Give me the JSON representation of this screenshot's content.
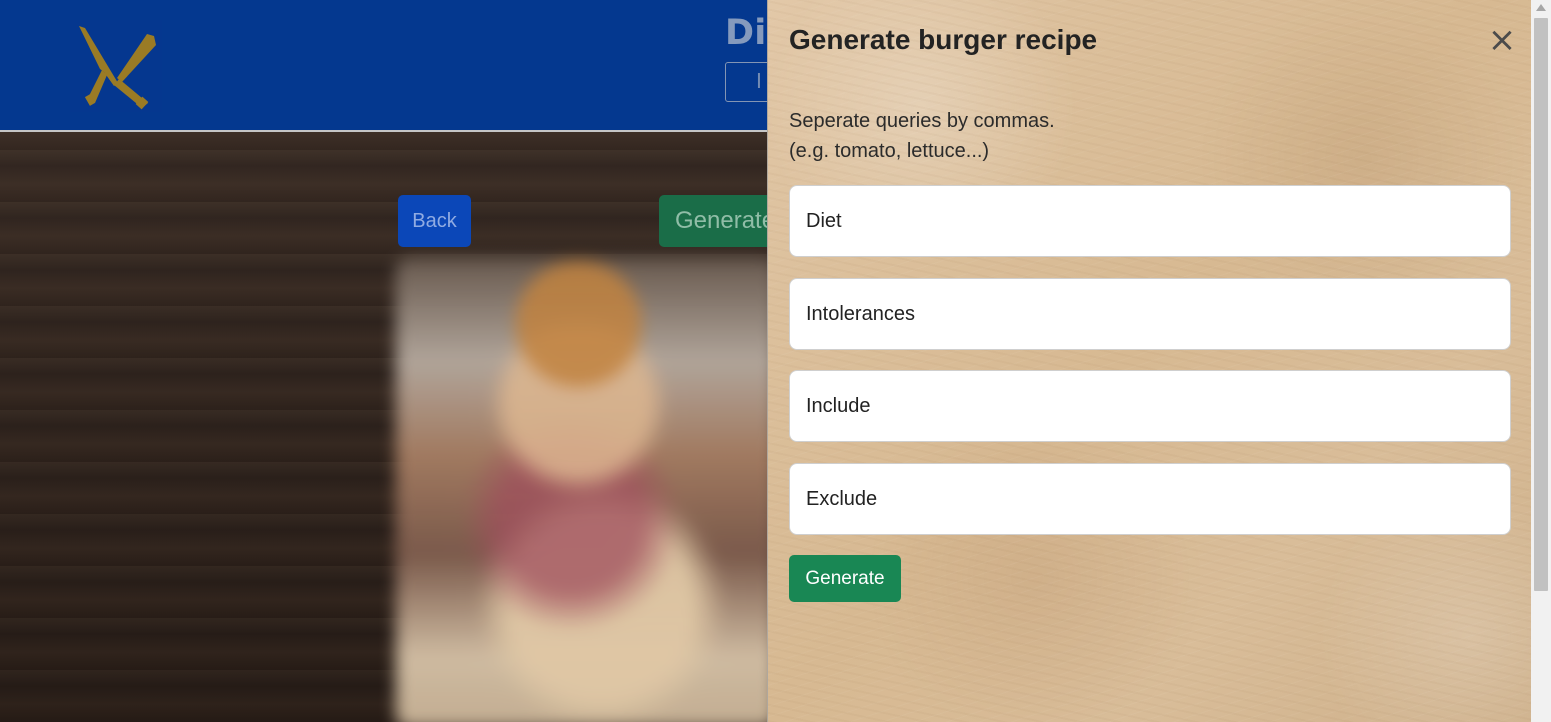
{
  "navbar": {
    "title_fragment": "Di",
    "box_fragment": "I"
  },
  "background": {
    "back_label": "Back",
    "generate_label": "Generate"
  },
  "panel": {
    "title": "Generate burger recipe",
    "close_symbol": "×",
    "help_line_1": "Seperate queries by commas.",
    "help_line_2": "(e.g. tomato, lettuce...)",
    "fields": [
      {
        "placeholder": "Diet"
      },
      {
        "placeholder": "Intolerances"
      },
      {
        "placeholder": "Include"
      },
      {
        "placeholder": "Exclude"
      }
    ],
    "generate_label": "Generate"
  },
  "colors": {
    "navbar": "#04388f",
    "logo": "#9a7b25",
    "back_button": "#0b47b8",
    "generate_button": "#198754",
    "panel_text": "#232323"
  },
  "icons": {
    "logo": "crossed-knives-icon",
    "close": "close-icon"
  }
}
